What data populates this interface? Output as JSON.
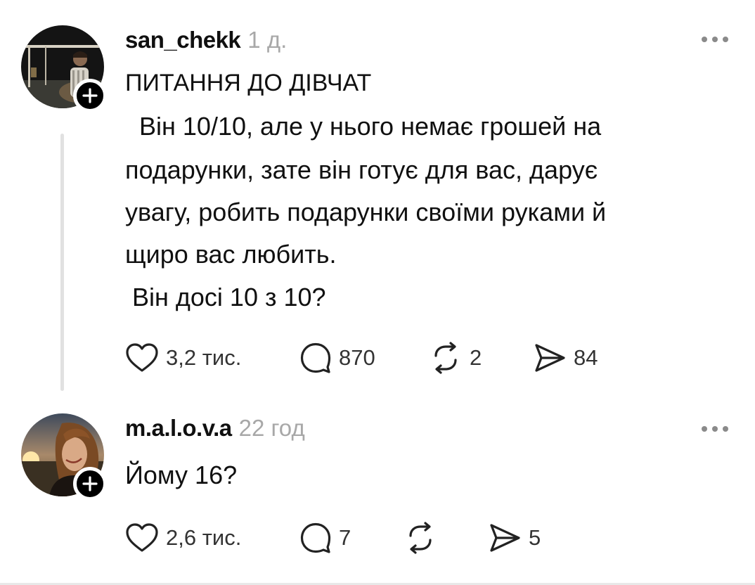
{
  "posts": [
    {
      "username": "san_chekk",
      "time": "1 д.",
      "avatar_icon": "avatar-photo",
      "lines": [
        "ПИТАННЯ ДО ДІВЧАТ",
        "  Він 10/10, але у нього немає грошей на",
        "подарунки, зате він готує для вас, дарує",
        "увагу, робить подарунки своїми руками й",
        "щиро вас любить.",
        " Він досі 10 з 10?"
      ],
      "likes": "3,2 тис.",
      "replies": "870",
      "reposts": "2",
      "shares": "84"
    },
    {
      "username": "m.a.l.o.v.a",
      "time": "22 год",
      "avatar_icon": "avatar-photo",
      "lines": [
        "Йому 16?"
      ],
      "likes": "2,6 тис.",
      "replies": "7",
      "reposts": "",
      "shares": "5"
    }
  ],
  "colors": {
    "text": "#101010",
    "muted": "#a8a8a8",
    "thread_line": "#e1e1e1"
  }
}
